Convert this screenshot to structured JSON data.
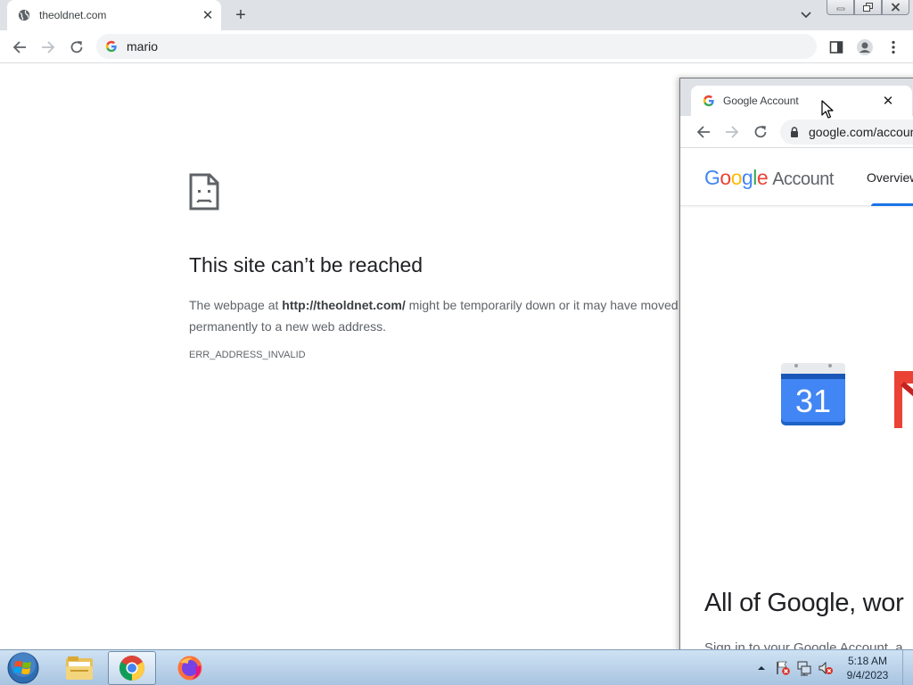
{
  "main_window": {
    "tab": {
      "title": "theoldnet.com",
      "close": "✕"
    },
    "new_tab": "+",
    "omnibox": {
      "text": "mario"
    },
    "error": {
      "title": "This site can’t be reached",
      "desc_prefix": "The webpage at ",
      "desc_url": "http://theoldnet.com/",
      "desc_suffix": " might be temporarily down or it may have moved permanently to a new web address.",
      "code": "ERR_ADDRESS_INVALID"
    }
  },
  "popup_window": {
    "tab": {
      "title": "Google Account",
      "close": "✕"
    },
    "omnibox": {
      "text": "google.com/account"
    },
    "header": {
      "logo_word": "Google",
      "logo_suffix": "Account",
      "nav_overview": "Overview"
    },
    "calendar_day": "31",
    "headline": "All of Google, wor",
    "subline": "Sign in to your Google Account, a"
  },
  "taskbar": {
    "clock_time": "5:18 AM",
    "clock_date": "9/4/2023",
    "apps": [
      "windows-explorer",
      "google-chrome",
      "firefox"
    ]
  },
  "colors": {
    "google_blue": "#4285F4",
    "google_red": "#EA4335",
    "google_yellow": "#FBBC05",
    "google_green": "#34A853",
    "accent_blue": "#1a73e8"
  }
}
